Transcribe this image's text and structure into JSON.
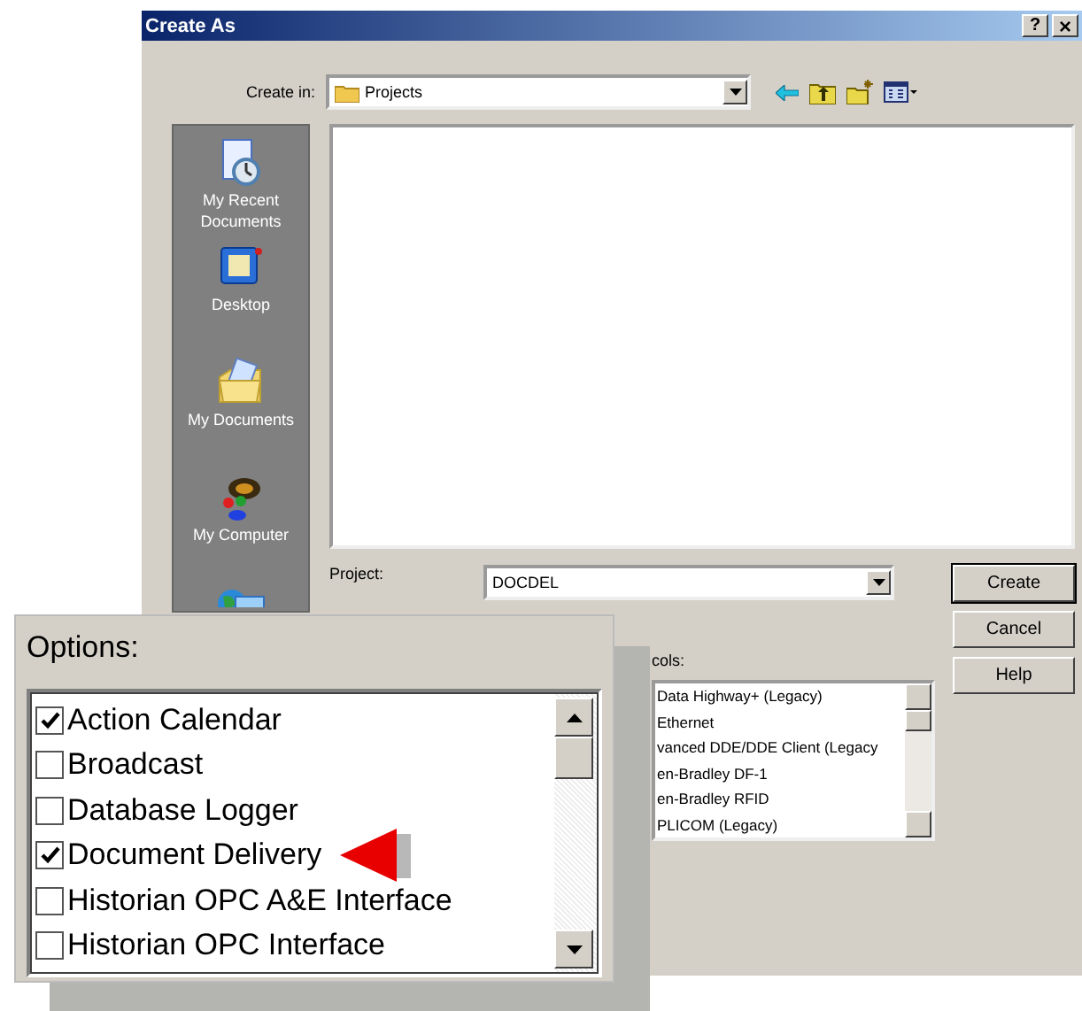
{
  "window": {
    "title": "Create As",
    "title_buttons": [
      {
        "kind": "help",
        "label": "?"
      },
      {
        "kind": "close",
        "label": "×"
      }
    ]
  },
  "create_in": {
    "label": "Create in:",
    "value": "Projects"
  },
  "places": [
    {
      "kind": "recent",
      "label": "My Recent Documents"
    },
    {
      "kind": "desktop",
      "label": "Desktop"
    },
    {
      "kind": "documents",
      "label": "My Documents"
    },
    {
      "kind": "computer",
      "label": "My Computer"
    },
    {
      "kind": "network"
    }
  ],
  "project": {
    "label": "Project:",
    "value": "DOCDEL"
  },
  "buttons": [
    "Create",
    "Cancel",
    "Help"
  ],
  "protocols": {
    "label": "cols:",
    "items": [
      "Data Highway+ (Legacy)",
      "Ethernet",
      "vanced DDE/DDE Client (Legacy",
      "en-Bradley DF-1",
      "en-Bradley RFID",
      "PLICOM (Legacy)"
    ]
  },
  "options": {
    "title": "Options:",
    "items": [
      {
        "label": "Action Calendar",
        "checked": true
      },
      {
        "label": "Broadcast",
        "checked": false
      },
      {
        "label": "Database Logger",
        "checked": false
      },
      {
        "label": "Document Delivery",
        "checked": true,
        "pointer": true
      },
      {
        "label": "Historian OPC A&E Interface",
        "checked": false
      },
      {
        "label": "Historian OPC Interface",
        "checked": false
      }
    ]
  }
}
